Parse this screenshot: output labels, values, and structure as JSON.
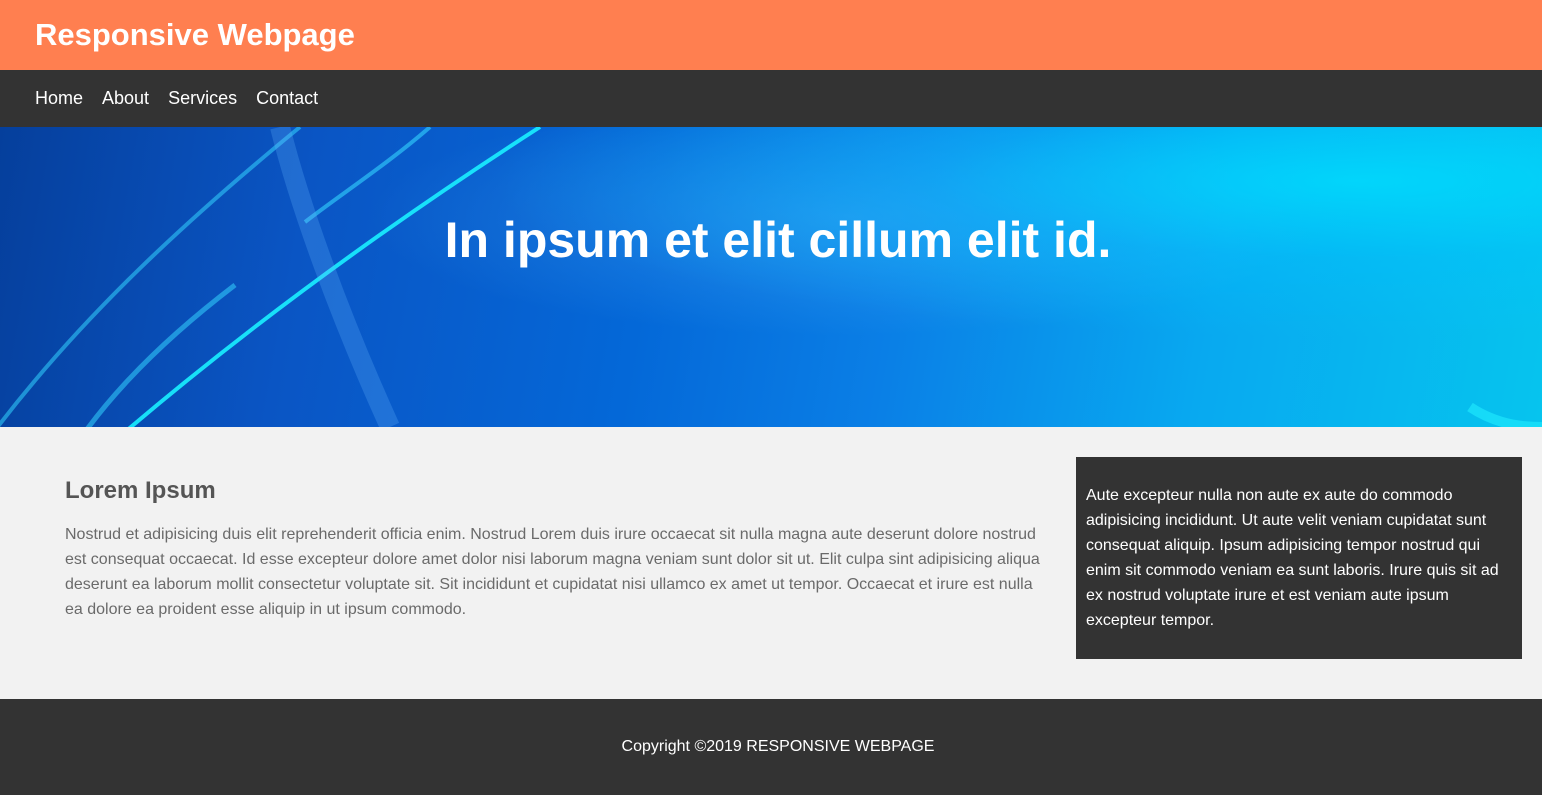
{
  "header": {
    "title": "Responsive Webpage"
  },
  "nav": {
    "items": [
      {
        "label": "Home"
      },
      {
        "label": "About"
      },
      {
        "label": "Services"
      },
      {
        "label": "Contact"
      }
    ]
  },
  "hero": {
    "heading": "In ipsum et elit cillum elit id."
  },
  "main": {
    "heading": "Lorem Ipsum",
    "body": "Nostrud et adipisicing duis elit reprehenderit officia enim. Nostrud Lorem duis irure occaecat sit nulla magna aute deserunt dolore nostrud est consequat occaecat. Id esse excepteur dolore amet dolor nisi laborum magna veniam sunt dolor sit ut. Elit culpa sint adipisicing aliqua deserunt ea laborum mollit consectetur voluptate sit. Sit incididunt et cupidatat nisi ullamco ex amet ut tempor. Occaecat et irure est nulla ea dolore ea proident esse aliquip in ut ipsum commodo."
  },
  "sidebar": {
    "text": "Aute excepteur nulla non aute ex aute do commodo adipisicing incididunt. Ut aute velit veniam cupidatat sunt consequat aliquip. Ipsum adipisicing tempor nostrud qui enim sit commodo veniam ea sunt laboris. Irure quis sit ad ex nostrud voluptate irure et est veniam aute ipsum excepteur tempor."
  },
  "footer": {
    "text": "Copyright ©2019 RESPONSIVE WEBPAGE"
  },
  "colors": {
    "header_bg": "#ff7f50",
    "nav_bg": "#333333",
    "page_bg": "#f2f2f2",
    "sidebar_bg": "#333333",
    "footer_bg": "#333333"
  }
}
